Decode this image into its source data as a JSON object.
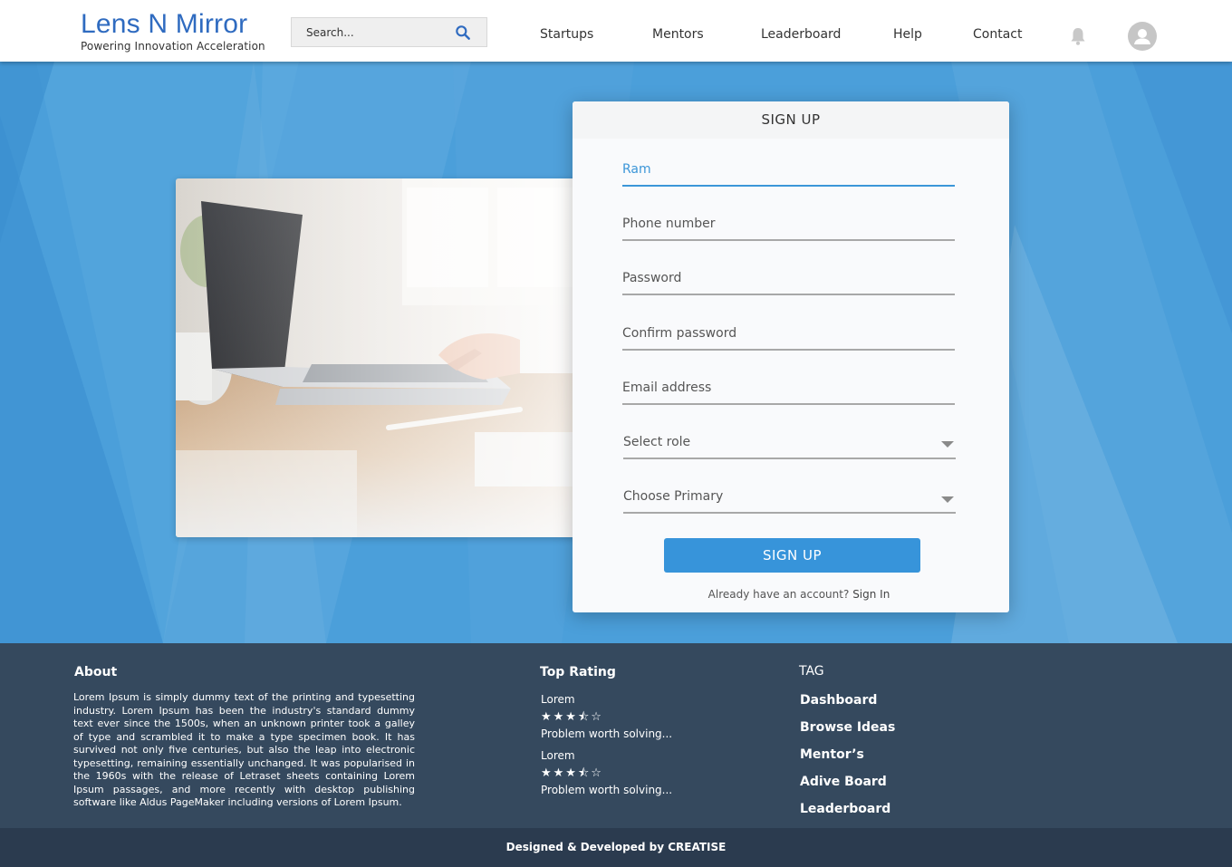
{
  "header": {
    "brand_title": "Lens N Mirror",
    "brand_tagline": "Powering Innovation Acceleration",
    "search_placeholder": "Search...",
    "nav": [
      "Startups",
      "Mentors",
      "Leaderboard",
      "Help",
      "Contact"
    ],
    "icons": {
      "search": "search-icon",
      "notifications": "bell-icon",
      "profile": "user-avatar-icon"
    }
  },
  "signup": {
    "title": "SIGN UP",
    "name_value": "Ram",
    "phone_placeholder": "Phone number",
    "password_placeholder": "Password",
    "confirm_password_placeholder": "Confirm password",
    "email_placeholder": "Email address",
    "role_select": "Select role",
    "primary_select": "Choose Primary",
    "submit_label": "SIGN UP",
    "signin_prompt": "Already have an account?",
    "signin_link": "Sign In"
  },
  "footer": {
    "about": {
      "title": "About",
      "text": "Lorem Ipsum is simply dummy text of the printing and typesetting industry. Lorem Ipsum has been the industry's standard dummy text ever since the 1500s, when an unknown printer took a galley of type and scrambled it to make a type specimen book. It has survived not only five centuries, but also the leap into electronic typesetting, remaining essentially unchanged. It was popularised in the 1960s with the release of Letraset sheets containing Lorem Ipsum passages, and more recently with desktop publishing software like Aldus PageMaker including versions of Lorem Ipsum."
    },
    "top_rating": {
      "title": "Top Rating",
      "items": [
        {
          "name": "Lorem",
          "rating": 3.5,
          "stars": "★★★⯪☆",
          "caption": "Problem worth solving..."
        },
        {
          "name": "Lorem",
          "rating": 3.5,
          "stars": "★★★⯪☆",
          "caption": "Problem worth solving..."
        }
      ]
    },
    "tags": {
      "title": "TAG",
      "links": [
        "Dashboard",
        "Browse Ideas",
        "Mentor’s",
        "Adive Board",
        "Leaderboard"
      ]
    },
    "credit": "Designed & Developed by CREATISE"
  },
  "colors": {
    "brand": "#2f6bc0",
    "hero_bg": "#4a9ed9",
    "accent": "#3794da",
    "footer_bg": "#35495e",
    "footer_bottom": "#2b3b4f"
  }
}
